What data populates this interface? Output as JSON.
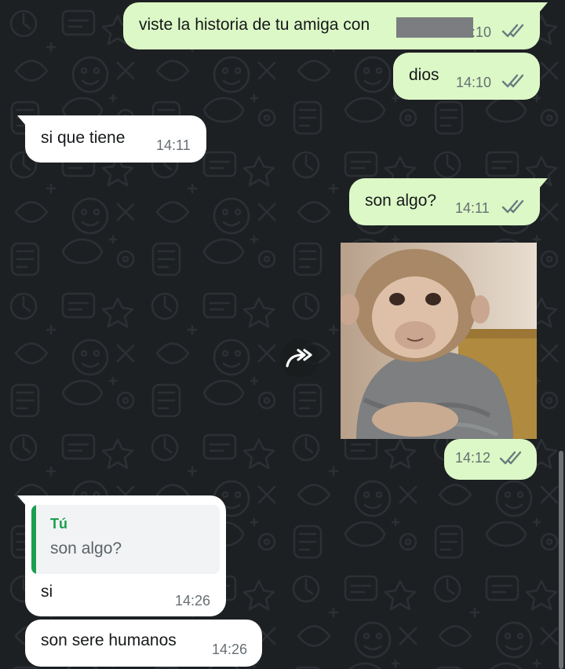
{
  "chat": {
    "messages": [
      {
        "text": "viste la historia de tu amiga con",
        "time": ":10"
      },
      {
        "text": "dios",
        "time": "14:10"
      },
      {
        "text": "si que tiene",
        "time": "14:11"
      },
      {
        "text": "son algo?",
        "time": "14:11"
      },
      {
        "time": "14:12",
        "image_subject": "monkey-in-knit-sweater"
      },
      {
        "quote_author": "Tú",
        "quote_text": "son algo?",
        "text": "si",
        "time": "14:26"
      },
      {
        "text": "son sere humanos",
        "time": "14:26"
      }
    ]
  },
  "colors": {
    "background": "#1d2023",
    "outgoing_bubble": "#dcf8c6",
    "incoming_bubble": "#ffffff",
    "quote_accent": "#1a9f4e",
    "read_ticks": "#6b7a7f"
  },
  "icons": {
    "read_receipt": "double-check-icon",
    "forward": "forward-arrow-icon"
  }
}
